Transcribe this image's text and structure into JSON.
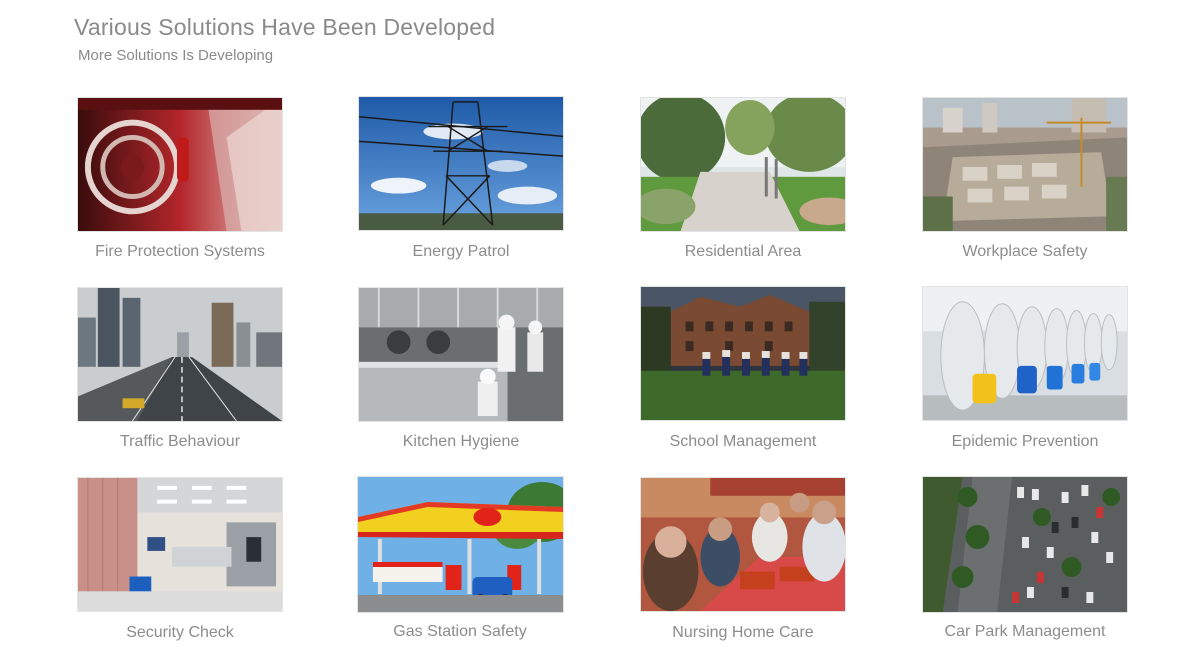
{
  "header": {
    "title": "Various Solutions Have Been Developed",
    "subtitle": "More Solutions Is Developing"
  },
  "solutions": [
    {
      "label": "Fire Protection Systems",
      "image": "fire-hose-reel-photo"
    },
    {
      "label": "Energy Patrol",
      "image": "power-tower-photo"
    },
    {
      "label": "Residential Area",
      "image": "garden-path-photo"
    },
    {
      "label": "Workplace Safety",
      "image": "construction-site-photo"
    },
    {
      "label": "Traffic Behaviour",
      "image": "city-highway-photo"
    },
    {
      "label": "Kitchen Hygiene",
      "image": "commercial-kitchen-photo"
    },
    {
      "label": "School Management",
      "image": "school-students-photo"
    },
    {
      "label": "Epidemic Prevention",
      "image": "disinfection-workers-photo"
    },
    {
      "label": "Security Check",
      "image": "security-scanner-photo"
    },
    {
      "label": "Gas Station Safety",
      "image": "gas-station-photo"
    },
    {
      "label": "Nursing Home Care",
      "image": "elderly-dining-photo"
    },
    {
      "label": "Car Park Management",
      "image": "parking-lot-aerial-photo"
    }
  ]
}
